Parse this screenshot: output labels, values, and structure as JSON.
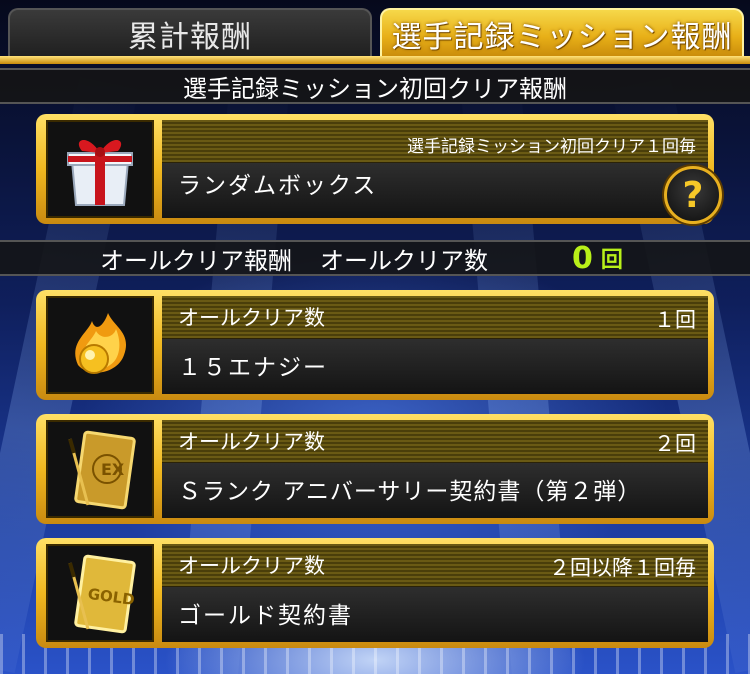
{
  "tabs": {
    "cumulative": "累計報酬",
    "player_record_mission": "選手記録ミッション報酬"
  },
  "first_clear_section": {
    "title": "選手記録ミッション初回クリア報酬",
    "reward": {
      "condition": "選手記録ミッション初回クリア１回毎",
      "name": "ランダムボックス",
      "icon": "gift-box-icon",
      "help": "?"
    }
  },
  "all_clear_section": {
    "label": "オールクリア報酬",
    "count_label": "オールクリア数",
    "count": "0",
    "count_unit": "回",
    "count_color": "#b8f019",
    "rewards": [
      {
        "condition_label": "オールクリア数",
        "condition_value": "１回",
        "name": "１５エナジー",
        "icon": "fire-energy-icon"
      },
      {
        "condition_label": "オールクリア数",
        "condition_value": "２回",
        "name": "Ｓランク アニバーサリー契約書（第２弾）",
        "icon": "s-rank-ex-contract-icon"
      },
      {
        "condition_label": "オールクリア数",
        "condition_value": "２回以降１回毎",
        "name": "ゴールド契約書",
        "icon": "gold-contract-icon"
      }
    ]
  },
  "colors": {
    "accent_gold": "#f0b820",
    "tab_active": "#e8b018"
  }
}
